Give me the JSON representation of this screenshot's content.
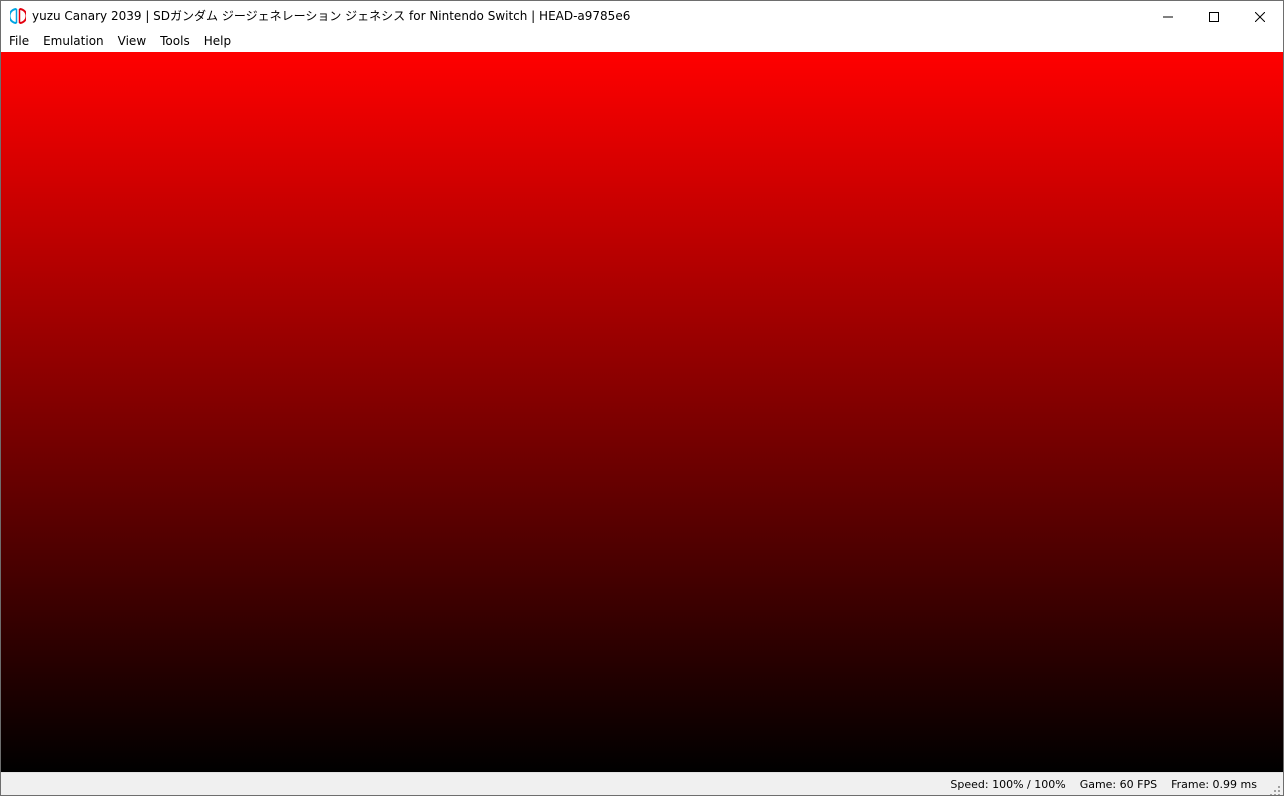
{
  "window": {
    "title": "yuzu Canary 2039 | SDガンダム ジージェネレーション ジェネシス for Nintendo Switch | HEAD-a9785e6",
    "icon": "yuzu-logo-icon",
    "controls": {
      "minimize_icon": "minimize-icon",
      "maximize_icon": "maximize-icon",
      "close_icon": "close-icon"
    }
  },
  "menubar": {
    "items": [
      {
        "label": "File"
      },
      {
        "label": "Emulation"
      },
      {
        "label": "View"
      },
      {
        "label": "Tools"
      },
      {
        "label": "Help"
      }
    ]
  },
  "render": {
    "gradient_top": "#ff0000",
    "gradient_bottom": "#000000"
  },
  "statusbar": {
    "speed": "Speed: 100% / 100%",
    "game_fps": "Game: 60 FPS",
    "frame_time": "Frame: 0.99 ms"
  },
  "colors": {
    "logo_red": "#e4000f",
    "logo_blue": "#00a5e3"
  }
}
